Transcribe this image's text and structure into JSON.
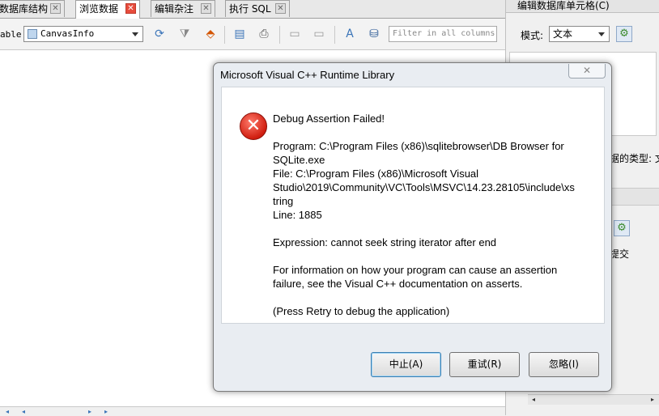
{
  "tabs": [
    {
      "label": "数据库结构",
      "active": false
    },
    {
      "label": "浏览数据",
      "active": true
    },
    {
      "label": "编辑杂注",
      "active": false
    },
    {
      "label": "执行 SQL",
      "active": false
    }
  ],
  "toolbar": {
    "table_label": "able:",
    "table_value": "CanvasInfo",
    "filter_placeholder": "Filter in all columns"
  },
  "dock": {
    "title": "编辑数据库单元格(C)",
    "mode_label": "模式:",
    "mode_value": "文本",
    "type_text": "据的类型: 文",
    "commit_text": "提交"
  },
  "dialog": {
    "title": "Microsoft Visual C++ Runtime Library",
    "close_label": "✕",
    "heading": "Debug Assertion Failed!",
    "program_line": "Program: C:\\Program Files (x86)\\sqlitebrowser\\DB Browser for\nSQLite.exe",
    "file_line": "File: C:\\Program Files (x86)\\Microsoft Visual\nStudio\\2019\\Community\\VC\\Tools\\MSVC\\14.23.28105\\include\\xs\ntring",
    "line_line": "Line: 1885",
    "expression": "Expression: cannot seek string iterator after end",
    "info": "For information on how your program can cause an assertion\nfailure, see the Visual C++ documentation on asserts.",
    "retry_hint": "(Press Retry to debug the application)",
    "buttons": {
      "abort": "中止(A)",
      "retry": "重试(R)",
      "ignore": "忽略(I)"
    }
  }
}
